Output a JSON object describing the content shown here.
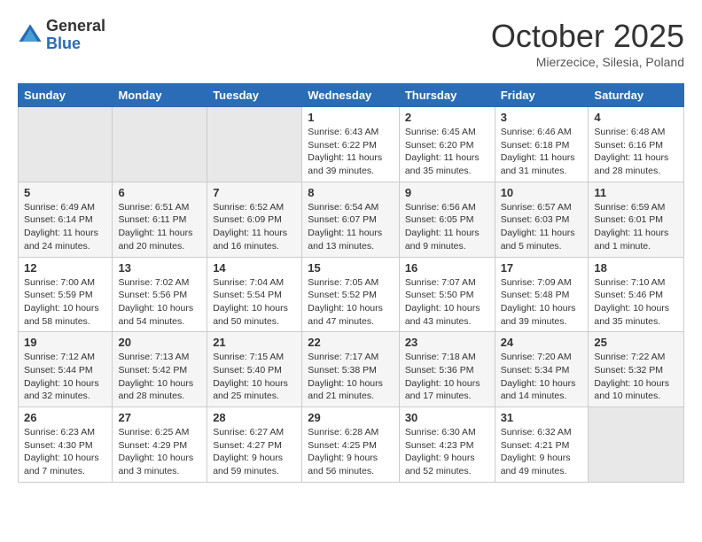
{
  "logo": {
    "general": "General",
    "blue": "Blue"
  },
  "header": {
    "month": "October 2025",
    "location": "Mierzecice, Silesia, Poland"
  },
  "weekdays": [
    "Sunday",
    "Monday",
    "Tuesday",
    "Wednesday",
    "Thursday",
    "Friday",
    "Saturday"
  ],
  "weeks": [
    [
      {
        "day": "",
        "sunrise": "",
        "sunset": "",
        "daylight": ""
      },
      {
        "day": "",
        "sunrise": "",
        "sunset": "",
        "daylight": ""
      },
      {
        "day": "",
        "sunrise": "",
        "sunset": "",
        "daylight": ""
      },
      {
        "day": "1",
        "sunrise": "Sunrise: 6:43 AM",
        "sunset": "Sunset: 6:22 PM",
        "daylight": "Daylight: 11 hours and 39 minutes."
      },
      {
        "day": "2",
        "sunrise": "Sunrise: 6:45 AM",
        "sunset": "Sunset: 6:20 PM",
        "daylight": "Daylight: 11 hours and 35 minutes."
      },
      {
        "day": "3",
        "sunrise": "Sunrise: 6:46 AM",
        "sunset": "Sunset: 6:18 PM",
        "daylight": "Daylight: 11 hours and 31 minutes."
      },
      {
        "day": "4",
        "sunrise": "Sunrise: 6:48 AM",
        "sunset": "Sunset: 6:16 PM",
        "daylight": "Daylight: 11 hours and 28 minutes."
      }
    ],
    [
      {
        "day": "5",
        "sunrise": "Sunrise: 6:49 AM",
        "sunset": "Sunset: 6:14 PM",
        "daylight": "Daylight: 11 hours and 24 minutes."
      },
      {
        "day": "6",
        "sunrise": "Sunrise: 6:51 AM",
        "sunset": "Sunset: 6:11 PM",
        "daylight": "Daylight: 11 hours and 20 minutes."
      },
      {
        "day": "7",
        "sunrise": "Sunrise: 6:52 AM",
        "sunset": "Sunset: 6:09 PM",
        "daylight": "Daylight: 11 hours and 16 minutes."
      },
      {
        "day": "8",
        "sunrise": "Sunrise: 6:54 AM",
        "sunset": "Sunset: 6:07 PM",
        "daylight": "Daylight: 11 hours and 13 minutes."
      },
      {
        "day": "9",
        "sunrise": "Sunrise: 6:56 AM",
        "sunset": "Sunset: 6:05 PM",
        "daylight": "Daylight: 11 hours and 9 minutes."
      },
      {
        "day": "10",
        "sunrise": "Sunrise: 6:57 AM",
        "sunset": "Sunset: 6:03 PM",
        "daylight": "Daylight: 11 hours and 5 minutes."
      },
      {
        "day": "11",
        "sunrise": "Sunrise: 6:59 AM",
        "sunset": "Sunset: 6:01 PM",
        "daylight": "Daylight: 11 hours and 1 minute."
      }
    ],
    [
      {
        "day": "12",
        "sunrise": "Sunrise: 7:00 AM",
        "sunset": "Sunset: 5:59 PM",
        "daylight": "Daylight: 10 hours and 58 minutes."
      },
      {
        "day": "13",
        "sunrise": "Sunrise: 7:02 AM",
        "sunset": "Sunset: 5:56 PM",
        "daylight": "Daylight: 10 hours and 54 minutes."
      },
      {
        "day": "14",
        "sunrise": "Sunrise: 7:04 AM",
        "sunset": "Sunset: 5:54 PM",
        "daylight": "Daylight: 10 hours and 50 minutes."
      },
      {
        "day": "15",
        "sunrise": "Sunrise: 7:05 AM",
        "sunset": "Sunset: 5:52 PM",
        "daylight": "Daylight: 10 hours and 47 minutes."
      },
      {
        "day": "16",
        "sunrise": "Sunrise: 7:07 AM",
        "sunset": "Sunset: 5:50 PM",
        "daylight": "Daylight: 10 hours and 43 minutes."
      },
      {
        "day": "17",
        "sunrise": "Sunrise: 7:09 AM",
        "sunset": "Sunset: 5:48 PM",
        "daylight": "Daylight: 10 hours and 39 minutes."
      },
      {
        "day": "18",
        "sunrise": "Sunrise: 7:10 AM",
        "sunset": "Sunset: 5:46 PM",
        "daylight": "Daylight: 10 hours and 35 minutes."
      }
    ],
    [
      {
        "day": "19",
        "sunrise": "Sunrise: 7:12 AM",
        "sunset": "Sunset: 5:44 PM",
        "daylight": "Daylight: 10 hours and 32 minutes."
      },
      {
        "day": "20",
        "sunrise": "Sunrise: 7:13 AM",
        "sunset": "Sunset: 5:42 PM",
        "daylight": "Daylight: 10 hours and 28 minutes."
      },
      {
        "day": "21",
        "sunrise": "Sunrise: 7:15 AM",
        "sunset": "Sunset: 5:40 PM",
        "daylight": "Daylight: 10 hours and 25 minutes."
      },
      {
        "day": "22",
        "sunrise": "Sunrise: 7:17 AM",
        "sunset": "Sunset: 5:38 PM",
        "daylight": "Daylight: 10 hours and 21 minutes."
      },
      {
        "day": "23",
        "sunrise": "Sunrise: 7:18 AM",
        "sunset": "Sunset: 5:36 PM",
        "daylight": "Daylight: 10 hours and 17 minutes."
      },
      {
        "day": "24",
        "sunrise": "Sunrise: 7:20 AM",
        "sunset": "Sunset: 5:34 PM",
        "daylight": "Daylight: 10 hours and 14 minutes."
      },
      {
        "day": "25",
        "sunrise": "Sunrise: 7:22 AM",
        "sunset": "Sunset: 5:32 PM",
        "daylight": "Daylight: 10 hours and 10 minutes."
      }
    ],
    [
      {
        "day": "26",
        "sunrise": "Sunrise: 6:23 AM",
        "sunset": "Sunset: 4:30 PM",
        "daylight": "Daylight: 10 hours and 7 minutes."
      },
      {
        "day": "27",
        "sunrise": "Sunrise: 6:25 AM",
        "sunset": "Sunset: 4:29 PM",
        "daylight": "Daylight: 10 hours and 3 minutes."
      },
      {
        "day": "28",
        "sunrise": "Sunrise: 6:27 AM",
        "sunset": "Sunset: 4:27 PM",
        "daylight": "Daylight: 9 hours and 59 minutes."
      },
      {
        "day": "29",
        "sunrise": "Sunrise: 6:28 AM",
        "sunset": "Sunset: 4:25 PM",
        "daylight": "Daylight: 9 hours and 56 minutes."
      },
      {
        "day": "30",
        "sunrise": "Sunrise: 6:30 AM",
        "sunset": "Sunset: 4:23 PM",
        "daylight": "Daylight: 9 hours and 52 minutes."
      },
      {
        "day": "31",
        "sunrise": "Sunrise: 6:32 AM",
        "sunset": "Sunset: 4:21 PM",
        "daylight": "Daylight: 9 hours and 49 minutes."
      },
      {
        "day": "",
        "sunrise": "",
        "sunset": "",
        "daylight": ""
      }
    ]
  ]
}
